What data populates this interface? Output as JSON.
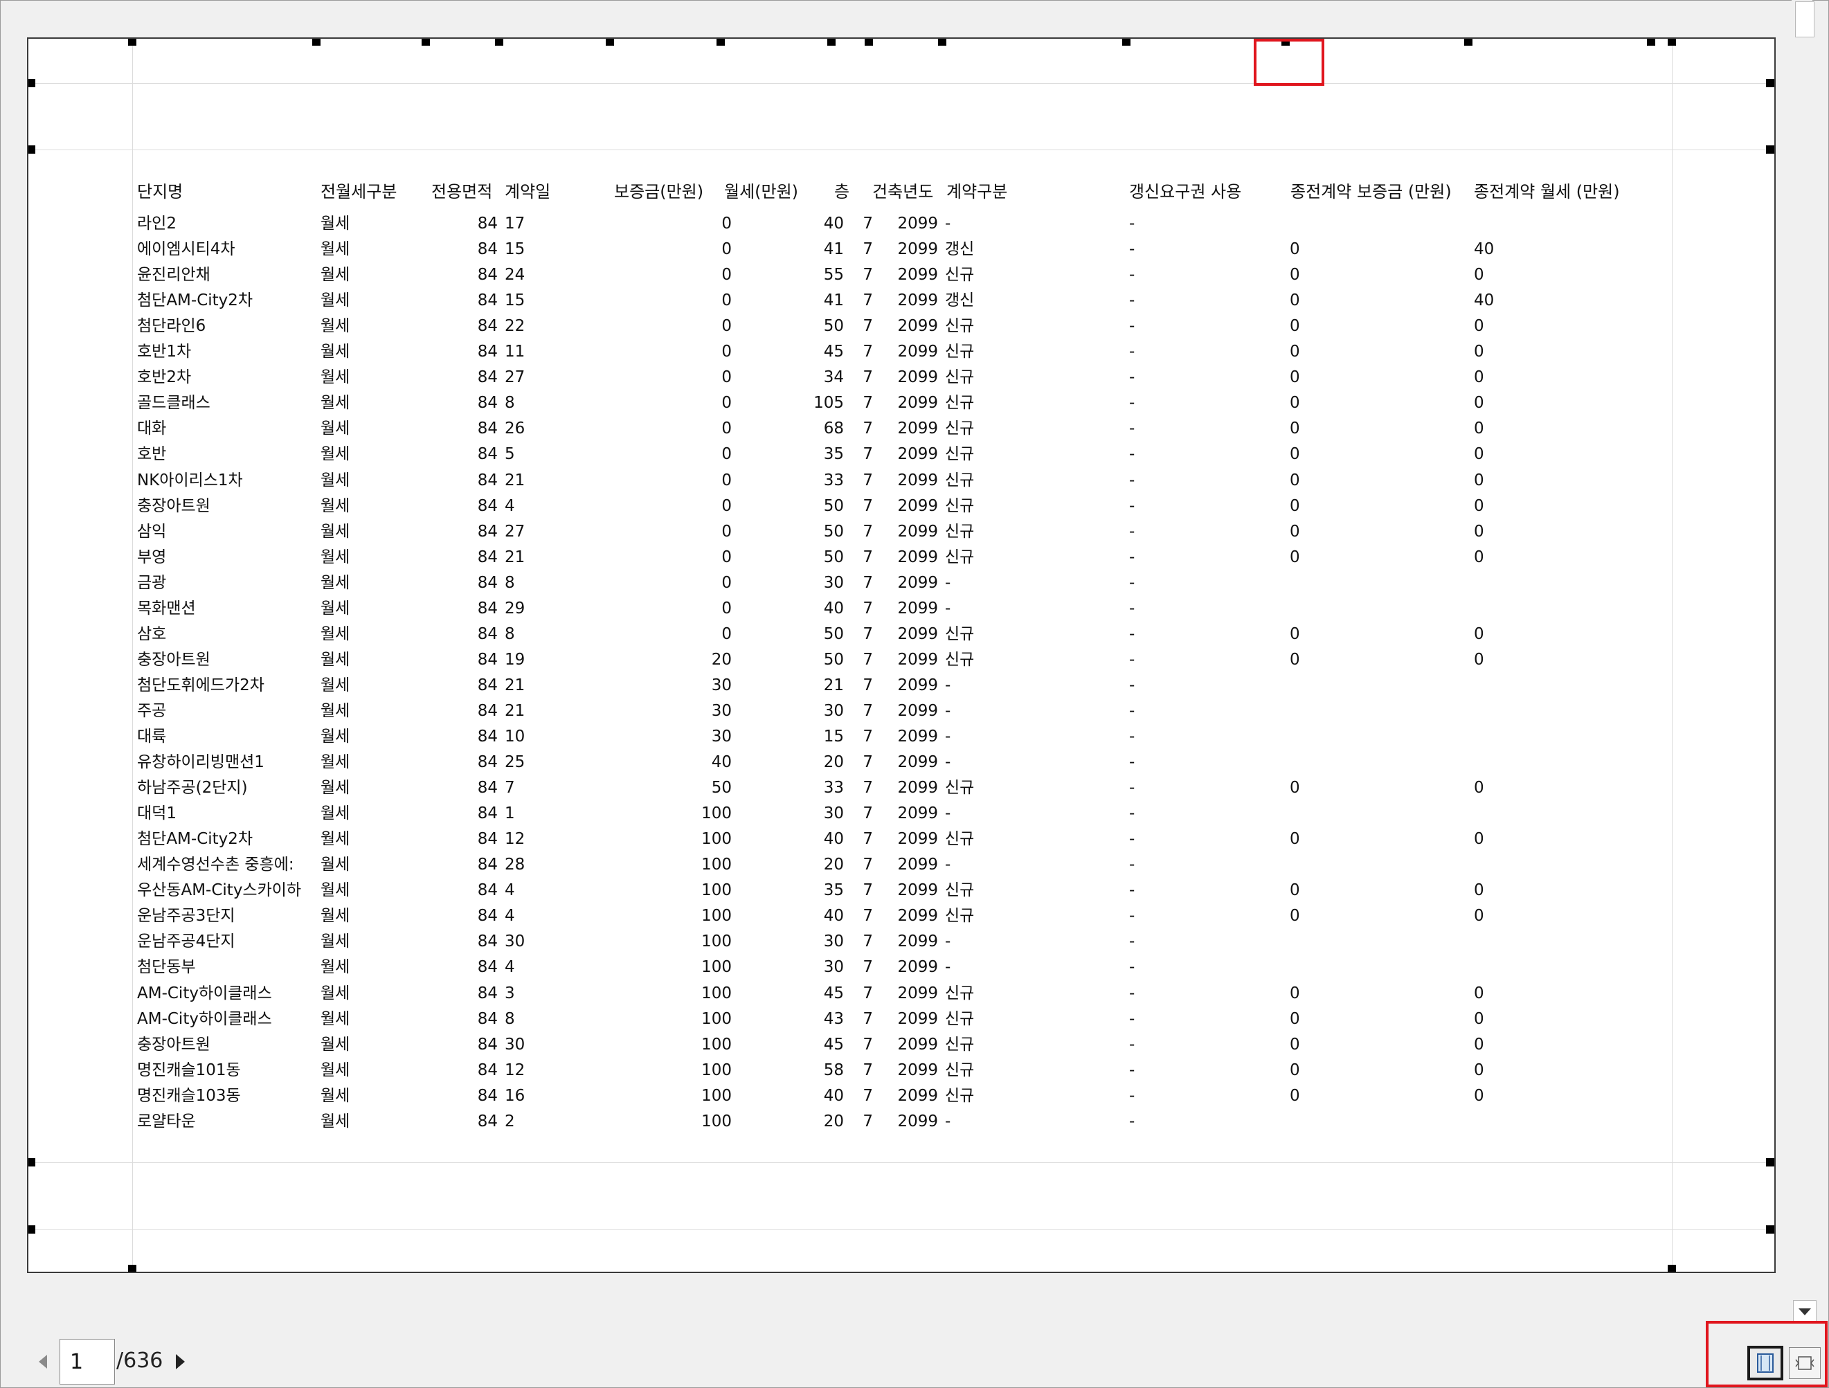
{
  "report": {
    "headers": {
      "complex": "단지명",
      "rent_type": "전월세구분",
      "area": "전용면적",
      "contract_day": "계약일",
      "deposit": "보증금(만원)",
      "monthly": "월세(만원)",
      "floor": "층",
      "built_year": "건축년도",
      "contract_type": "계약구분",
      "renewal": "갱신요구권 사용",
      "prev_deposit": "종전계약 보증금 (만원)",
      "prev_monthly": "종전계약 월세 (만원)"
    },
    "rows": [
      [
        "라인2",
        "월세",
        "84",
        "17",
        "0",
        "40",
        "7",
        "2099",
        "-",
        "-",
        "",
        ""
      ],
      [
        "에이엠시티4차",
        "월세",
        "84",
        "15",
        "0",
        "41",
        "7",
        "2099",
        "갱신",
        "-",
        "0",
        "40"
      ],
      [
        "윤진리안채",
        "월세",
        "84",
        "24",
        "0",
        "55",
        "7",
        "2099",
        "신규",
        "-",
        "0",
        "0"
      ],
      [
        "첨단AM-City2차",
        "월세",
        "84",
        "15",
        "0",
        "41",
        "7",
        "2099",
        "갱신",
        "-",
        "0",
        "40"
      ],
      [
        "첨단라인6",
        "월세",
        "84",
        "22",
        "0",
        "50",
        "7",
        "2099",
        "신규",
        "-",
        "0",
        "0"
      ],
      [
        "호반1차",
        "월세",
        "84",
        "11",
        "0",
        "45",
        "7",
        "2099",
        "신규",
        "-",
        "0",
        "0"
      ],
      [
        "호반2차",
        "월세",
        "84",
        "27",
        "0",
        "34",
        "7",
        "2099",
        "신규",
        "-",
        "0",
        "0"
      ],
      [
        "골드클래스",
        "월세",
        "84",
        "8",
        "0",
        "105",
        "7",
        "2099",
        "신규",
        "-",
        "0",
        "0"
      ],
      [
        "대화",
        "월세",
        "84",
        "26",
        "0",
        "68",
        "7",
        "2099",
        "신규",
        "-",
        "0",
        "0"
      ],
      [
        "호반",
        "월세",
        "84",
        "5",
        "0",
        "35",
        "7",
        "2099",
        "신규",
        "-",
        "0",
        "0"
      ],
      [
        "NK아이리스1차",
        "월세",
        "84",
        "21",
        "0",
        "33",
        "7",
        "2099",
        "신규",
        "-",
        "0",
        "0"
      ],
      [
        "충장아트원",
        "월세",
        "84",
        "4",
        "0",
        "50",
        "7",
        "2099",
        "신규",
        "-",
        "0",
        "0"
      ],
      [
        "삼익",
        "월세",
        "84",
        "27",
        "0",
        "50",
        "7",
        "2099",
        "신규",
        "-",
        "0",
        "0"
      ],
      [
        "부영",
        "월세",
        "84",
        "21",
        "0",
        "50",
        "7",
        "2099",
        "신규",
        "-",
        "0",
        "0"
      ],
      [
        "금광",
        "월세",
        "84",
        "8",
        "0",
        "30",
        "7",
        "2099",
        "-",
        "-",
        "",
        ""
      ],
      [
        "목화맨션",
        "월세",
        "84",
        "29",
        "0",
        "40",
        "7",
        "2099",
        "-",
        "-",
        "",
        ""
      ],
      [
        "삼호",
        "월세",
        "84",
        "8",
        "0",
        "50",
        "7",
        "2099",
        "신규",
        "-",
        "0",
        "0"
      ],
      [
        "충장아트원",
        "월세",
        "84",
        "19",
        "20",
        "50",
        "7",
        "2099",
        "신규",
        "-",
        "0",
        "0"
      ],
      [
        "첨단도휘에드가2차",
        "월세",
        "84",
        "21",
        "30",
        "21",
        "7",
        "2099",
        "-",
        "-",
        "",
        ""
      ],
      [
        "주공",
        "월세",
        "84",
        "21",
        "30",
        "30",
        "7",
        "2099",
        "-",
        "-",
        "",
        ""
      ],
      [
        "대륙",
        "월세",
        "84",
        "10",
        "30",
        "15",
        "7",
        "2099",
        "-",
        "-",
        "",
        ""
      ],
      [
        "유창하이리빙맨션1",
        "월세",
        "84",
        "25",
        "40",
        "20",
        "7",
        "2099",
        "-",
        "-",
        "",
        ""
      ],
      [
        "하남주공(2단지)",
        "월세",
        "84",
        "7",
        "50",
        "33",
        "7",
        "2099",
        "신규",
        "-",
        "0",
        "0"
      ],
      [
        "대덕1",
        "월세",
        "84",
        "1",
        "100",
        "30",
        "7",
        "2099",
        "-",
        "-",
        "",
        ""
      ],
      [
        "첨단AM-City2차",
        "월세",
        "84",
        "12",
        "100",
        "40",
        "7",
        "2099",
        "신규",
        "-",
        "0",
        "0"
      ],
      [
        "세계수영선수촌 중흥에:",
        "월세",
        "84",
        "28",
        "100",
        "20",
        "7",
        "2099",
        "-",
        "-",
        "",
        ""
      ],
      [
        "우산동AM-City스카이하",
        "월세",
        "84",
        "4",
        "100",
        "35",
        "7",
        "2099",
        "신규",
        "-",
        "0",
        "0"
      ],
      [
        "운남주공3단지",
        "월세",
        "84",
        "4",
        "100",
        "40",
        "7",
        "2099",
        "신규",
        "-",
        "0",
        "0"
      ],
      [
        "운남주공4단지",
        "월세",
        "84",
        "30",
        "100",
        "30",
        "7",
        "2099",
        "-",
        "-",
        "",
        ""
      ],
      [
        "첨단동부",
        "월세",
        "84",
        "4",
        "100",
        "30",
        "7",
        "2099",
        "-",
        "-",
        "",
        ""
      ],
      [
        "AM-City하이클래스",
        "월세",
        "84",
        "3",
        "100",
        "45",
        "7",
        "2099",
        "신규",
        "-",
        "0",
        "0"
      ],
      [
        "AM-City하이클래스",
        "월세",
        "84",
        "8",
        "100",
        "43",
        "7",
        "2099",
        "신규",
        "-",
        "0",
        "0"
      ],
      [
        "충장아트원",
        "월세",
        "84",
        "30",
        "100",
        "45",
        "7",
        "2099",
        "신규",
        "-",
        "0",
        "0"
      ],
      [
        "명진캐슬101동",
        "월세",
        "84",
        "12",
        "100",
        "58",
        "7",
        "2099",
        "신규",
        "-",
        "0",
        "0"
      ],
      [
        "명진캐슬103동",
        "월세",
        "84",
        "16",
        "100",
        "40",
        "7",
        "2099",
        "신규",
        "-",
        "0",
        "0"
      ],
      [
        "로얄타운",
        "월세",
        "84",
        "2",
        "100",
        "20",
        "7",
        "2099",
        "-",
        "-",
        "",
        ""
      ]
    ]
  },
  "pager": {
    "current_page": "1",
    "total_pages": "/636"
  },
  "icons": {
    "prev": "chevron-left-icon",
    "next": "chevron-right-icon",
    "scroll_down": "triangle-down-icon",
    "fit_page": "fit-page-icon",
    "fit_width": "fit-width-icon"
  },
  "colors": {
    "highlight": "#e0161e",
    "page_border": "#3a3a3a",
    "guide": "#dcdcdc"
  }
}
